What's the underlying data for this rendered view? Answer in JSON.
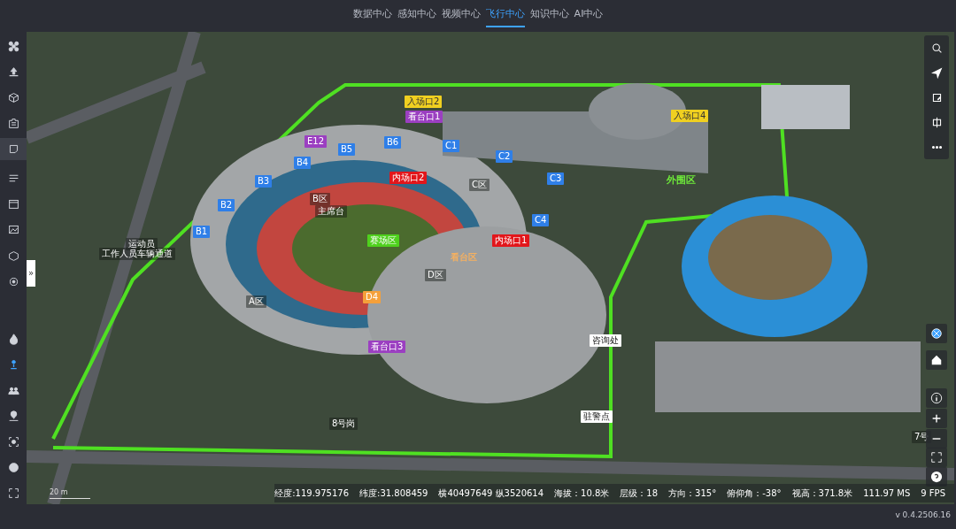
{
  "nav_tabs": [
    {
      "label": "数据中心",
      "selected": false
    },
    {
      "label": "感知中心",
      "selected": false
    },
    {
      "label": "视频中心",
      "selected": false
    },
    {
      "label": "飞行中心",
      "selected": true
    },
    {
      "label": "知识中心",
      "selected": false
    },
    {
      "label": "AI中心",
      "selected": false
    }
  ],
  "left_tools": [
    {
      "selected": false
    },
    {
      "selected": false
    },
    {
      "selected": false
    },
    {
      "selected": false
    },
    {
      "selected": true
    },
    {
      "selected": false
    },
    {
      "selected": false
    },
    {
      "selected": false
    },
    {
      "selected": false
    },
    {
      "selected": false
    },
    {
      "selected": false
    },
    {
      "selected": true
    },
    {
      "selected": false
    },
    {
      "selected": false
    },
    {
      "selected": false
    },
    {
      "selected": false
    },
    {
      "selected": false
    }
  ],
  "collapse_handle": "»",
  "map": {
    "labels": [
      {
        "text": "入场口2",
        "kind": "entry"
      },
      {
        "text": "看台口1",
        "kind": "stand"
      },
      {
        "text": "入场口4",
        "kind": "entry"
      },
      {
        "text": "E12",
        "kind": "stand"
      },
      {
        "text": "B6",
        "kind": "gate"
      },
      {
        "text": "B5",
        "kind": "gate"
      },
      {
        "text": "B4",
        "kind": "gate"
      },
      {
        "text": "B3",
        "kind": "gate"
      },
      {
        "text": "B2",
        "kind": "gate"
      },
      {
        "text": "B1",
        "kind": "gate"
      },
      {
        "text": "C1",
        "kind": "gate"
      },
      {
        "text": "C2",
        "kind": "gate"
      },
      {
        "text": "C3",
        "kind": "gate"
      },
      {
        "text": "C4",
        "kind": "gate"
      },
      {
        "text": "B区",
        "kind": "zone"
      },
      {
        "text": "主席台",
        "kind": "zone"
      },
      {
        "text": "C区",
        "kind": "zone"
      },
      {
        "text": "A区",
        "kind": "zone"
      },
      {
        "text": "D区",
        "kind": "zone"
      },
      {
        "text": "内场口2",
        "kind": "inner"
      },
      {
        "text": "内场口1",
        "kind": "inner"
      },
      {
        "text": "赛场区",
        "kind": "field"
      },
      {
        "text": "看台区",
        "kind": "area"
      },
      {
        "text": "D4",
        "kind": "channel"
      },
      {
        "text": "看台口3",
        "kind": "stand"
      },
      {
        "text": "运动员",
        "kind": "zone"
      },
      {
        "text": "工作人员车辆通道",
        "kind": "zone"
      },
      {
        "text": "外围区",
        "kind": "outer"
      },
      {
        "text": "咨询处",
        "kind": "post"
      },
      {
        "text": "驻警点",
        "kind": "post"
      },
      {
        "text": "8号岗",
        "kind": "zone"
      },
      {
        "text": "7号",
        "kind": "zone"
      }
    ],
    "scale": "20 m"
  },
  "status_bar": [
    "经度:119.975176",
    "纬度:31.808459",
    "横40497649 纵3520614",
    "海拔：10.8米",
    "层级：18",
    "方向：315°",
    "俯仰角：-38°",
    "视高：371.8米",
    "111.97 MS",
    "9 FPS"
  ],
  "version": "v 0.4.2506.16"
}
